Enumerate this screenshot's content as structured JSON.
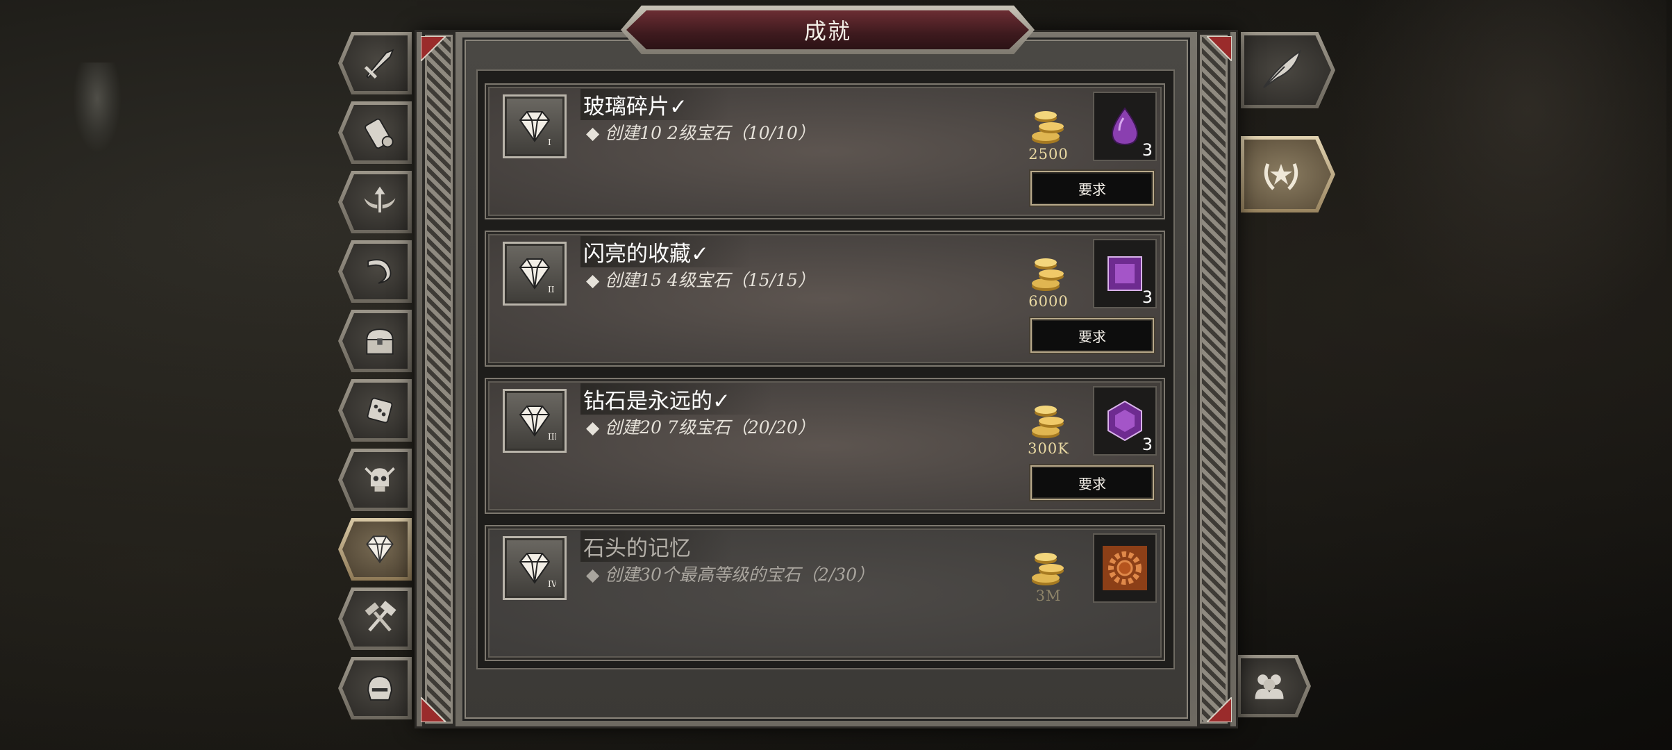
{
  "window": {
    "title": "成就"
  },
  "achievements": [
    {
      "title": "玻璃碎片✓",
      "desc": "◆ 创建10 2级宝石（10/10）",
      "tier": "I",
      "coins": "2500",
      "reward_count": "3",
      "button": "要求",
      "gem": "drop",
      "locked": false
    },
    {
      "title": "闪亮的收藏✓",
      "desc": "◆ 创建15 4级宝石（15/15）",
      "tier": "II",
      "coins": "6000",
      "reward_count": "3",
      "button": "要求",
      "gem": "square",
      "locked": false
    },
    {
      "title": "钻石是永远的✓",
      "desc": "◆ 创建20 7级宝石（20/20）",
      "tier": "III",
      "coins": "300K",
      "reward_count": "3",
      "button": "要求",
      "gem": "hexagon",
      "locked": false
    },
    {
      "title": "石头的记忆",
      "desc": "◆ 创建30个最高等级的宝石（2/30）",
      "tier": "IV",
      "coins": "3M",
      "reward_count": "",
      "button": "",
      "gem": "gear",
      "locked": true
    }
  ],
  "left_tabs": [
    {
      "name": "sword-icon"
    },
    {
      "name": "scroll-icon"
    },
    {
      "name": "winged-arrow-icon"
    },
    {
      "name": "horn-icon"
    },
    {
      "name": "chest-icon"
    },
    {
      "name": "dice-icon"
    },
    {
      "name": "skull-icon"
    },
    {
      "name": "gem-icon",
      "active": true
    },
    {
      "name": "hammers-icon"
    },
    {
      "name": "helmet-icon"
    }
  ],
  "right_tabs": [
    {
      "name": "quill-icon"
    },
    {
      "name": "laurel-star-icon",
      "active": true
    },
    {
      "name": "group-icon"
    }
  ],
  "colors": {
    "gem": "#8a3fb0",
    "coin": "#d9b24a",
    "banner": "#6b2d33",
    "reward_locked": "#b5541e"
  }
}
